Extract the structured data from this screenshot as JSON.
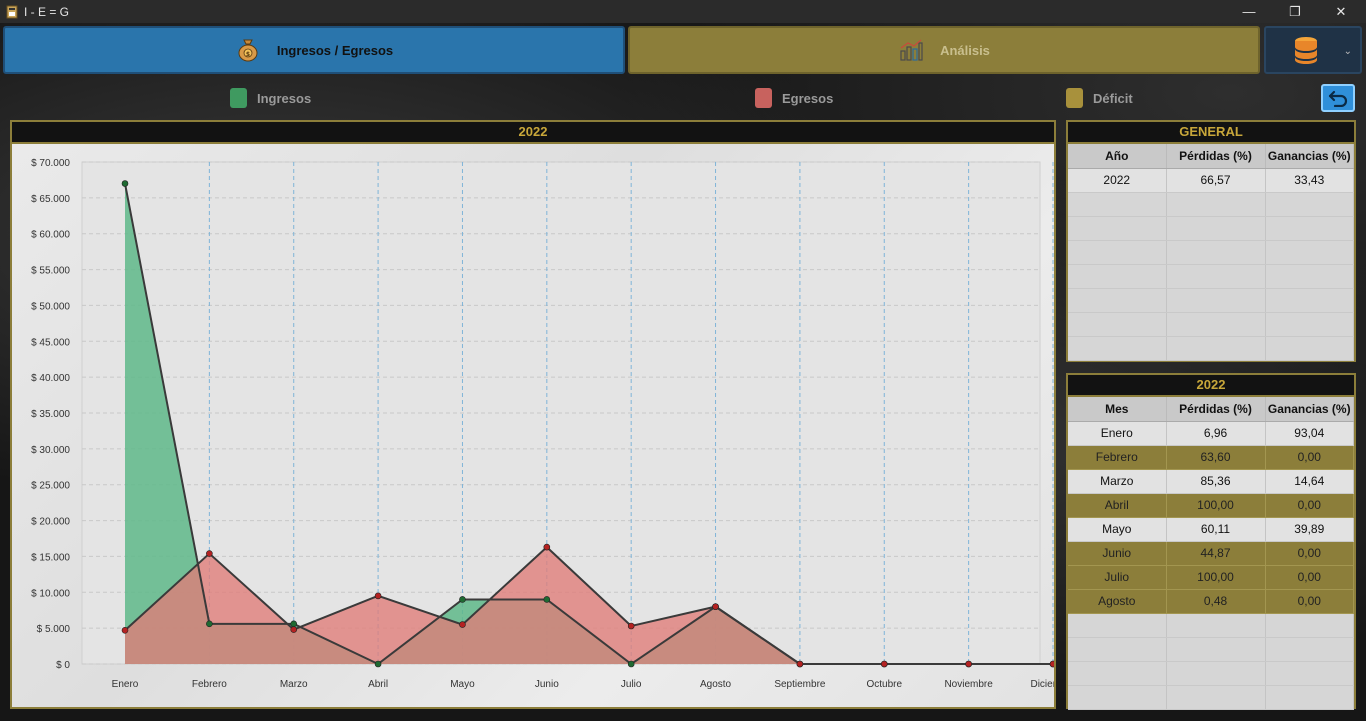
{
  "window": {
    "title": "I - E = G",
    "minimize": "—",
    "restore": "❐",
    "close": "✕"
  },
  "tabs": {
    "main_label": "Ingresos / Egresos",
    "analysis_label": "Análisis"
  },
  "legend": [
    {
      "label": "Ingresos",
      "color": "#3f9a60"
    },
    {
      "label": "Egresos",
      "color": "#c8625e"
    },
    {
      "label": "Déficit",
      "color": "#a8913c"
    }
  ],
  "chart_panel": {
    "title": "2022"
  },
  "chart_data": {
    "type": "area",
    "categories": [
      "Enero",
      "Febrero",
      "Marzo",
      "Abril",
      "Mayo",
      "Junio",
      "Julio",
      "Agosto",
      "Septiembre",
      "Octubre",
      "Noviembre",
      "Diciembre"
    ],
    "series": [
      {
        "name": "Ingresos",
        "color": "#5fb98a",
        "values": [
          67000,
          5600,
          5600,
          0,
          9000,
          9000,
          0,
          8000,
          0,
          0,
          0,
          0
        ]
      },
      {
        "name": "Egresos",
        "color": "#e07c78",
        "values": [
          4700,
          15400,
          4800,
          9500,
          5500,
          16300,
          5300,
          8000,
          0,
          0,
          0,
          0
        ]
      }
    ],
    "yticks": [
      "$ 0",
      "$ 5.000",
      "$ 10.000",
      "$ 15.000",
      "$ 20.000",
      "$ 25.000",
      "$ 30.000",
      "$ 35.000",
      "$ 40.000",
      "$ 45.000",
      "$ 50.000",
      "$ 55.000",
      "$ 60.000",
      "$ 65.000",
      "$ 70.000"
    ],
    "ylim": [
      0,
      70000
    ],
    "grid": true
  },
  "general_table": {
    "title": "GENERAL",
    "headers": [
      "Año",
      "Pérdidas (%)",
      "Ganancias (%)"
    ],
    "rows": [
      [
        "2022",
        "66,57",
        "33,43"
      ]
    ],
    "empty_rows": 7
  },
  "monthly_table": {
    "title": "2022",
    "headers": [
      "Mes",
      "Pérdidas (%)",
      "Ganancias (%)"
    ],
    "rows": [
      [
        "Enero",
        "6,96",
        "93,04"
      ],
      [
        "Febrero",
        "63,60",
        "0,00"
      ],
      [
        "Marzo",
        "85,36",
        "14,64"
      ],
      [
        "Abril",
        "100,00",
        "0,00"
      ],
      [
        "Mayo",
        "60,11",
        "39,89"
      ],
      [
        "Junio",
        "44,87",
        "0,00"
      ],
      [
        "Julio",
        "100,00",
        "0,00"
      ],
      [
        "Agosto",
        "0,48",
        "0,00"
      ]
    ],
    "row_styles": [
      "plain",
      "alt",
      "plain",
      "alt",
      "plain",
      "alt",
      "alt",
      "alt"
    ],
    "empty_rows": 4
  }
}
